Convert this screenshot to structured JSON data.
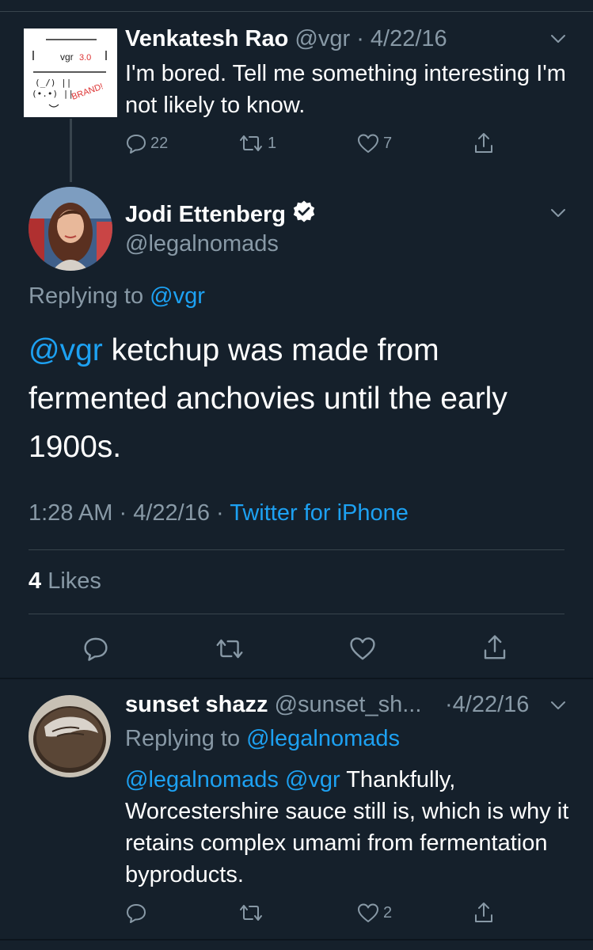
{
  "tweet1": {
    "avatar_text": {
      "label": "vgr",
      "version": "3.0",
      "badge": "BRAND!"
    },
    "name": "Venkatesh Rao",
    "handle": "@vgr",
    "date_sep": "·",
    "date": "4/22/16",
    "text": "I'm bored. Tell me something interesting I'm not likely to know.",
    "reply_count": "22",
    "retweet_count": "1",
    "like_count": "7"
  },
  "tweet2": {
    "name": "Jodi Ettenberg",
    "handle": "@legalnomads",
    "replying_prefix": "Replying to",
    "replying_to": "@vgr",
    "text_mention": "@vgr",
    "text_body": " ketchup was made from fermented anchovies until the early 1900s.",
    "time": "1:28 AM",
    "sep": "·",
    "date": "4/22/16",
    "source": "Twitter for iPhone",
    "likes_count": "4",
    "likes_label": "Likes"
  },
  "tweet3": {
    "name": "sunset shazz",
    "handle": "@sunset_sh...",
    "date": "·4/22/16",
    "replying_prefix": "Replying to",
    "replying_to": "@legalnomads",
    "mention1": "@legalnomads",
    "mention2": "@vgr",
    "text_body": " Thankfully, Worcestershire sauce still is, which is why it retains complex umami from fermentation byproducts.",
    "like_count": "2"
  },
  "colors": {
    "background": "#15202b",
    "muted": "#8899a6",
    "accent": "#1da1f2",
    "divider": "#38444d"
  },
  "icons": [
    "chevron-down-icon",
    "reply-icon",
    "retweet-icon",
    "heart-icon",
    "share-icon",
    "verified-badge-icon"
  ]
}
